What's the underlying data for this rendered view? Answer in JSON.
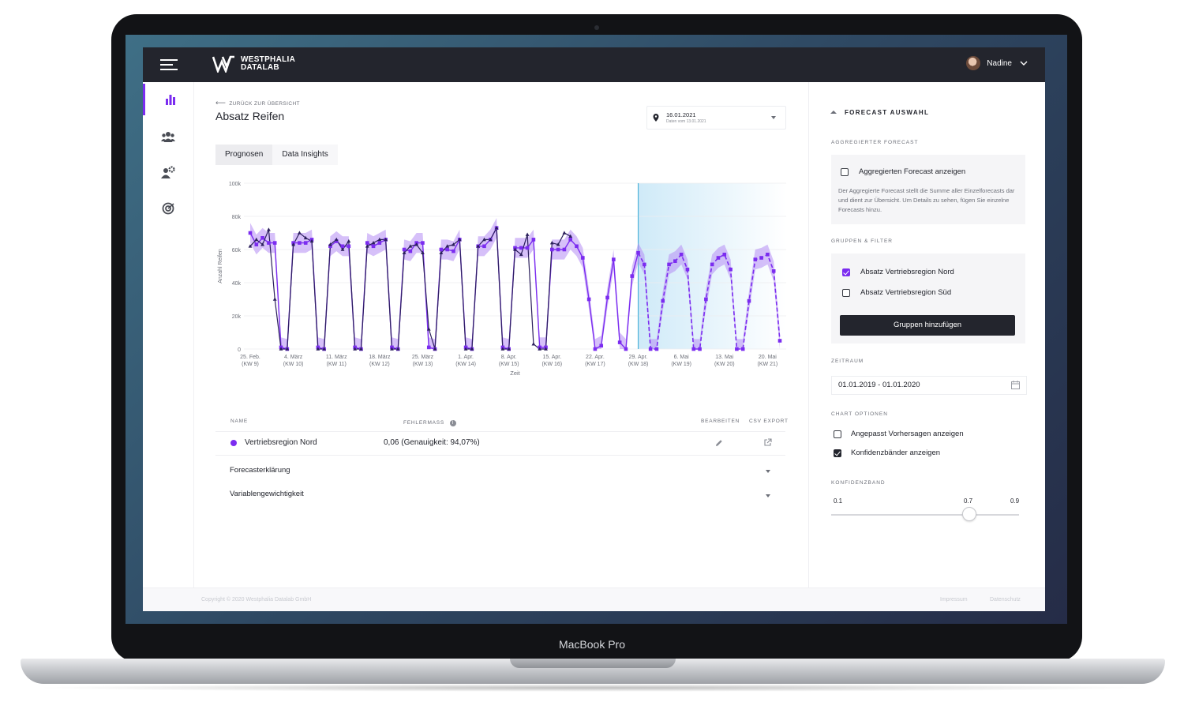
{
  "device": {
    "label": "MacBook Pro"
  },
  "header": {
    "logo_line1": "WESTPHALIA",
    "logo_line2": "DATALAB",
    "user_name": "Nadine"
  },
  "sidebar": {
    "items": [
      {
        "icon": "bar-chart-icon",
        "active": true
      },
      {
        "icon": "users-icon",
        "active": false
      },
      {
        "icon": "user-gear-icon",
        "active": false
      },
      {
        "icon": "target-icon",
        "active": false
      }
    ]
  },
  "main": {
    "back_label": "ZURÜCK ZUR ÜBERSICHT",
    "title": "Absatz Reifen",
    "date_select": {
      "date": "16.01.2021",
      "subtext": "Daten vom 13.01.2021"
    },
    "tabs": [
      {
        "label": "Prognosen",
        "active": true
      },
      {
        "label": "Data Insights",
        "active": false
      }
    ]
  },
  "chart_data": {
    "type": "line",
    "xlabel": "Zeit",
    "ylabel": "Anzahl Reifen",
    "ylim": [
      0,
      100000
    ],
    "yticks": [
      "0",
      "20k",
      "40k",
      "60k",
      "80k",
      "100k"
    ],
    "xticks": [
      {
        "date": "25. Feb.",
        "week": "(KW 9)"
      },
      {
        "date": "4. März",
        "week": "(KW 10)"
      },
      {
        "date": "11. März",
        "week": "(KW 11)"
      },
      {
        "date": "18. März",
        "week": "(KW 12)"
      },
      {
        "date": "25. März",
        "week": "(KW 13)"
      },
      {
        "date": "1. Apr.",
        "week": "(KW 14)"
      },
      {
        "date": "8. Apr.",
        "week": "(KW 15)"
      },
      {
        "date": "15. Apr.",
        "week": "(KW 16)"
      },
      {
        "date": "22. Apr.",
        "week": "(KW 17)"
      },
      {
        "date": "29. Apr.",
        "week": "(KW 18)"
      },
      {
        "date": "6. Mai",
        "week": "(KW 19)"
      },
      {
        "date": "13. Mai",
        "week": "(KW 20)"
      },
      {
        "date": "20. Mai",
        "week": "(KW 21)"
      }
    ],
    "forecast_start_index": 63,
    "series": [
      {
        "role": "actual",
        "color": "#2b1f5c",
        "values": [
          62,
          66,
          63,
          72,
          30,
          0,
          0,
          63,
          70,
          67,
          65,
          0,
          0,
          63,
          66,
          60,
          65,
          0,
          0,
          62,
          64,
          66,
          66,
          0,
          0,
          58,
          62,
          63,
          58,
          12,
          0,
          58,
          62,
          63,
          66,
          0,
          0,
          62,
          66,
          66,
          73,
          0,
          0,
          60,
          57,
          69,
          3,
          0,
          0,
          64,
          63,
          70,
          68
        ]
      },
      {
        "role": "forecast",
        "color": "#7b2cf0",
        "values": [
          70,
          63,
          67,
          64,
          64,
          1,
          0,
          64,
          64,
          64,
          66,
          1,
          0,
          62,
          65,
          62,
          62,
          1,
          0,
          64,
          62,
          64,
          66,
          1,
          0,
          60,
          59,
          64,
          64,
          1,
          0,
          60,
          60,
          59,
          66,
          1,
          0,
          62,
          62,
          66,
          73,
          1,
          0,
          61,
          61,
          61,
          66,
          1,
          1,
          60,
          60,
          60,
          66,
          62,
          55,
          30,
          0,
          2,
          31,
          54,
          4,
          0,
          44,
          58,
          51,
          0,
          0,
          29,
          51,
          53,
          57,
          48,
          0,
          0,
          30,
          51,
          55,
          57,
          48,
          0,
          0,
          29,
          54,
          55,
          57,
          47,
          5
        ]
      },
      {
        "role": "confidence",
        "color": "#b58cf4",
        "spread": 6
      }
    ]
  },
  "table": {
    "headers": {
      "name": "NAME",
      "error": "FEHLERMASS",
      "edit": "BEARBEITEN",
      "export": "CSV EXPORT"
    },
    "row": {
      "name": "Vertriebsregion Nord",
      "error_value": "0,06 (Genauigkeit: 94,07%)",
      "dot_color": "#7b2cf0"
    },
    "accordions": [
      "Forecasterklärung",
      "Variablengewichtigkeit"
    ]
  },
  "panel": {
    "title": "FORECAST AUSWAHL",
    "aggregate": {
      "label": "AGGREGIERTER FORECAST",
      "checkbox": "Aggregierten Forecast anzeigen",
      "checked": false,
      "description": "Der Aggregierte Forecast stellt die Summe aller Einzelforecasts dar und dient zur Übersicht. Um Details zu sehen, fügen Sie einzelne Forecasts hinzu."
    },
    "groups": {
      "label": "GRUPPEN & FILTER",
      "items": [
        {
          "label": "Absatz Vertriebsregion Nord",
          "checked": true
        },
        {
          "label": "Absatz Vertriebsregion Süd",
          "checked": false
        }
      ],
      "button": "Gruppen hinzufügen"
    },
    "period": {
      "label": "ZEITRAUM",
      "value": "01.01.2019 - 01.01.2020"
    },
    "options": {
      "label": "CHART OPTIONEN",
      "items": [
        {
          "label": "Angepasst Vorhersagen anzeigen",
          "checked": false
        },
        {
          "label": "Konfidenzbänder anzeigen",
          "checked": true
        }
      ]
    },
    "confidence": {
      "label": "KONFIDENZBAND",
      "min": "0.1",
      "value": "0.7",
      "max": "0.9",
      "fraction": 0.75
    }
  },
  "footer": {
    "copyright": "Copyright © 2020 Westphalia Datalab GmbH",
    "links": [
      "Impressum",
      "Datenschutz"
    ]
  },
  "colors": {
    "accent": "#7b2cf0",
    "dark": "#23252d",
    "forecast_bg": "#dff2fb"
  }
}
